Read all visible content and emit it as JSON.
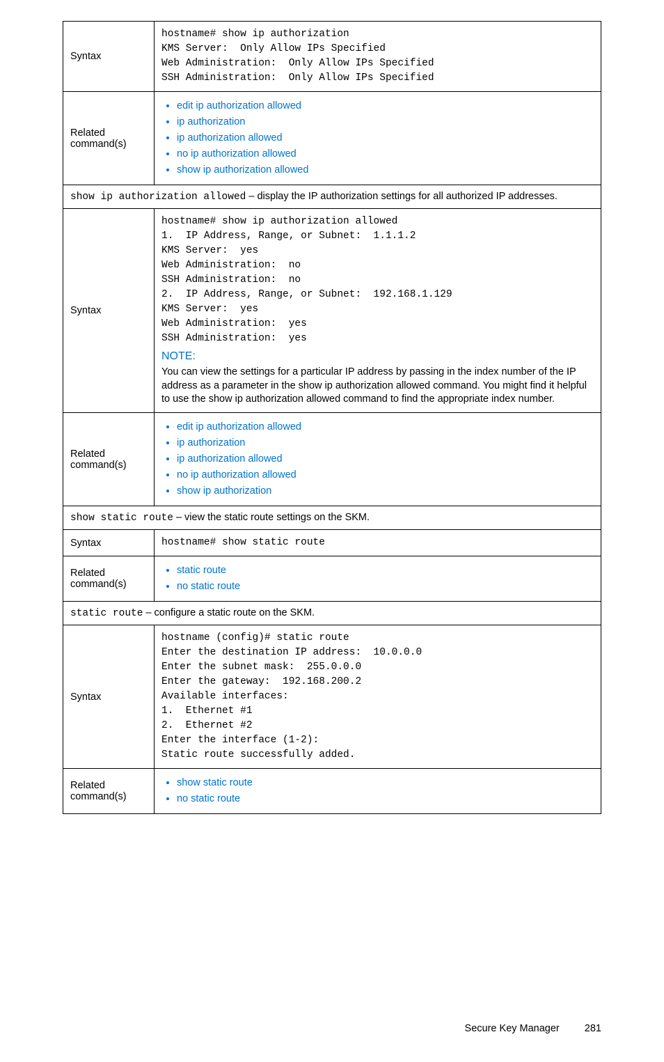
{
  "row1": {
    "label": "Syntax",
    "code": "hostname# show ip authorization\nKMS Server:  Only Allow IPs Specified\nWeb Administration:  Only Allow IPs Specified\nSSH Administration:  Only Allow IPs Specified"
  },
  "row2": {
    "label": "Related command(s)",
    "items": [
      "edit ip authorization allowed",
      "ip authorization",
      "ip authorization allowed",
      "no ip authorization allowed",
      "show ip authorization allowed"
    ]
  },
  "row3": {
    "cmd": "show ip authorization allowed",
    "desc": " – display the IP authorization settings for all authorized IP addresses."
  },
  "row4": {
    "label": "Syntax",
    "code": "hostname# show ip authorization allowed\n1.  IP Address, Range, or Subnet:  1.1.1.2\nKMS Server:  yes\nWeb Administration:  no\nSSH Administration:  no\n2.  IP Address, Range, or Subnet:  192.168.1.129\nKMS Server:  yes\nWeb Administration:  yes\nSSH Administration:  yes",
    "note_heading": "NOTE:",
    "note_body": "You can view the settings for a particular IP address by passing in the index number of the IP address as a parameter in the show ip authorization allowed command. You might find it helpful to use the show ip authorization allowed command to find the appropriate index number."
  },
  "row5": {
    "label": "Related command(s)",
    "items": [
      "edit ip authorization allowed",
      "ip authorization",
      "ip authorization allowed",
      "no ip authorization allowed",
      "show ip authorization"
    ]
  },
  "row6": {
    "cmd": "show static route",
    "desc": " – view the static route settings on the SKM."
  },
  "row7": {
    "label": "Syntax",
    "code": "hostname# show static route"
  },
  "row8": {
    "label": "Related command(s)",
    "items": [
      "static route",
      "no static route"
    ]
  },
  "row9": {
    "cmd": "static route",
    "desc": " – configure a static route on the SKM."
  },
  "row10": {
    "label": "Syntax",
    "code": "hostname (config)# static route\nEnter the destination IP address:  10.0.0.0\nEnter the subnet mask:  255.0.0.0\nEnter the gateway:  192.168.200.2\nAvailable interfaces:\n1.  Ethernet #1\n2.  Ethernet #2\nEnter the interface (1-2):\nStatic route successfully added."
  },
  "row11": {
    "label": "Related command(s)",
    "items": [
      "show static route",
      "no static route"
    ]
  },
  "footer": {
    "title": "Secure Key Manager",
    "page": "281"
  }
}
